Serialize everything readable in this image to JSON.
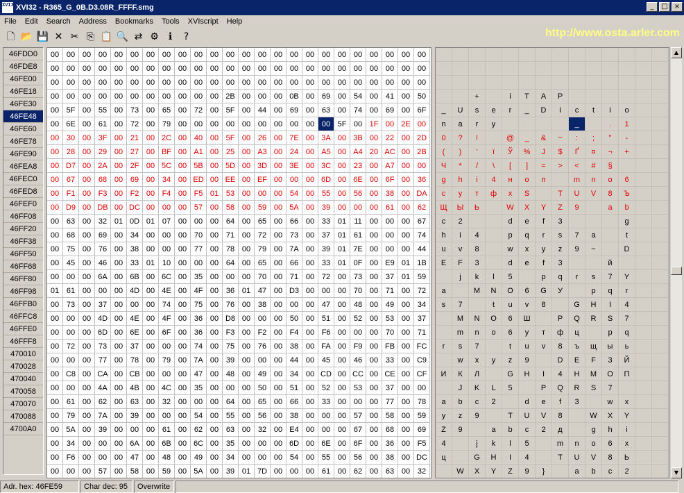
{
  "window": {
    "title": "XVI32 - R365_G_0B.D3.08R_FFFF.smg",
    "minimize": "_",
    "maximize": "□",
    "close": "×",
    "app_icon": "XVI32"
  },
  "menu": [
    "File",
    "Edit",
    "Search",
    "Address",
    "Bookmarks",
    "Tools",
    "XVIscript",
    "Help"
  ],
  "url": "http://www.osta.arler.com",
  "toolbar": [
    {
      "name": "new-file-icon",
      "glyph": "🗋"
    },
    {
      "name": "open-folder-icon",
      "glyph": "📂"
    },
    {
      "name": "save-icon",
      "glyph": "💾"
    },
    {
      "name": "close-file-icon",
      "glyph": "✕"
    },
    {
      "name": "cut-icon",
      "glyph": "✂"
    },
    {
      "name": "copy-icon",
      "glyph": "⎘"
    },
    {
      "name": "paste-icon",
      "glyph": "📋"
    },
    {
      "name": "find-icon",
      "glyph": "🔍"
    },
    {
      "name": "replace-icon",
      "glyph": "⇄"
    },
    {
      "name": "settings-icon",
      "glyph": "⚙"
    },
    {
      "name": "info-icon",
      "glyph": "ℹ"
    },
    {
      "name": "help-icon",
      "glyph": "?"
    }
  ],
  "addresses": [
    "46FDD0",
    "46FDE8",
    "46FE00",
    "46FE18",
    "46FE30",
    "46FE48",
    "46FE60",
    "46FE78",
    "46FE90",
    "46FEA8",
    "46FEC0",
    "46FED8",
    "46FEF0",
    "46FF08",
    "46FF20",
    "46FF38",
    "46FF50",
    "46FF68",
    "46FF80",
    "46FF98",
    "46FFB0",
    "46FFC8",
    "46FFE0",
    "46FFF8",
    "470010",
    "470028",
    "470040",
    "470058",
    "470070",
    "470088",
    "4700A0"
  ],
  "selected_address": "46FE48",
  "hex_rows": [
    "00 00 00 00 00 00 00 00 00 00 00 00 00 00 00 00 00 00 00 00 00 00 00 00",
    "00 00 00 00 00 00 00 00 00 00 00 00 00 00 00 00 00 00 00 00 00 00 00 00",
    "00 00 00 00 00 00 00 00 00 00 00 00 00 00 00 00 00 00 00 00 00 00 00 00",
    "00 00 00 00 00 00 00 00 00 00 00 2B 00 00 00 0B 00 69 00 54 00 41 00 50",
    "00 5F 00 55 00 73 00 65 00 72 00 5F 00 44 00 69 00 63 00 74 00 69 00 6F",
    "00 6E 00 61 00 72 00 79 00 00 00 00 00 00 00 00 5F 00 1F 00 2E 00 31",
    "00 30 00 3F 00 21 00 2C 00 40 00 5F 00 26 00 7E 00 3A 00 3B 00 22 00 2D",
    "00 28 00 29 00 27 00 BF 00 A1 00 25 00 A3 00 24 00 A5 00 A4 20 AC 00 2B",
    "00 D7 00 2A 00 2F 00 5C 00 5B 00 5D 00 3D 00 3E 00 3C 00 23 00 A7 00 00",
    "00 67 00 68 00 69 00 34 00 ED 00 EE 00 EF 00 00 00 6D 00 6E 00 6F 00 36",
    "00 F1 00 F3 00 F2 00 F4 00 F5 01 53 00 00 00 54 00 55 00 56 00 38 00 DA",
    "00 D9 00 DB 00 DC 00 00 00 57 00 58 00 59 00 5A 00 39 00 00 00 61 00 62",
    "00 63 00 32 01 0D 01 07 00 00 00 64 00 65 00 66 00 33 01 11 00 00 00 67",
    "00 68 00 69 00 34 00 00 00 70 00 71 00 72 00 73 00 37 01 61 00 00 00 74",
    "00 75 00 76 00 38 00 00 00 77 00 78 00 79 00 7A 00 39 01 7E 00 00 00 44",
    "00 45 00 46 00 33 01 10 00 00 00 64 00 65 00 66 00 33 01 0F 00 E9 01 1B",
    "00 00 00 6A 00 6B 00 6C 00 35 00 00 00 70 00 71 00 72 00 73 00 37 01 59",
    "01 61 00 00 00 4D 00 4E 00 4F 00 36 01 47 00 D3 00 00 00 70 00 71 00 72",
    "00 73 00 37 00 00 00 74 00 75 00 76 00 38 00 00 00 47 00 48 00 49 00 34",
    "00 00 00 4D 00 4E 00 4F 00 36 00 D8 00 00 00 50 00 51 00 52 00 53 00 37",
    "00 00 00 6D 00 6E 00 6F 00 36 00 F3 00 F2 00 F4 00 F6 00 00 00 70 00 71",
    "00 72 00 73 00 37 00 00 00 74 00 75 00 76 00 38 00 FA 00 F9 00 FB 00 FC",
    "00 00 00 77 00 78 00 79 00 7A 00 39 00 00 00 44 00 45 00 46 00 33 00 C9",
    "00 C8 00 CA 00 CB 00 00 00 47 00 48 00 49 00 34 00 CD 00 CC 00 CE 00 CF",
    "00 00 00 4A 00 4B 00 4C 00 35 00 00 00 50 00 51 00 52 00 53 00 37 00 00",
    "00 61 00 62 00 63 00 32 00 00 00 64 00 65 00 66 00 33 00 00 00 77 00 78",
    "00 79 00 7A 00 39 00 00 00 54 00 55 00 56 00 38 00 00 00 57 00 58 00 59",
    "00 5A 00 39 00 00 00 61 00 62 00 63 00 32 00 E4 00 00 00 67 00 68 00 69",
    "00 34 00 00 00 6A 00 6B 00 6C 00 35 00 00 00 6D 00 6E 00 6F 00 36 00 F5",
    "00 F6 00 00 00 47 00 48 00 49 00 34 00 00 00 54 00 55 00 56 00 38 00 DC",
    "00 00 00 57 00 58 00 59 00 5A 00 39 01 7D 00 00 00 61 00 62 00 63 00 32"
  ],
  "hex_row6_fix": "00 6E 00 61 00 72 00 79 00 00 00 00 00 00 00 00 00 00 5F 00 1F 00 2E 00 31",
  "red_rows": [
    5,
    6,
    7,
    8,
    9,
    10,
    11
  ],
  "red_row5_start": 20,
  "selected_hex": {
    "row": 5,
    "col": 17
  },
  "char_rows": [
    [
      "",
      "",
      "",
      "",
      "",
      "",
      "",
      "",
      "",
      "",
      "",
      "",
      "",
      ""
    ],
    [
      "",
      "",
      "",
      "",
      "",
      "",
      "",
      "",
      "",
      "",
      "",
      "",
      "",
      ""
    ],
    [
      "",
      "",
      "",
      "",
      "",
      "",
      "",
      "",
      "",
      "",
      "",
      "",
      "",
      ""
    ],
    [
      "",
      "",
      "",
      "",
      "",
      "+",
      "",
      "",
      "",
      "i",
      "",
      "T",
      "",
      "A",
      "",
      "P"
    ],
    [
      "",
      "_",
      "",
      "U",
      "",
      "s",
      "",
      "e",
      "",
      "r",
      "",
      "_",
      "",
      "D",
      "",
      "i",
      "",
      "c",
      "",
      "t",
      "",
      "i",
      "",
      "o"
    ],
    [
      "",
      "n",
      "",
      "a",
      "",
      "r",
      "",
      "y",
      "",
      "",
      "",
      "",
      "",
      "",
      "",
      "",
      "",
      "_",
      "",
      "",
      "",
      ".",
      "",
      "1"
    ],
    [
      "",
      "0",
      "",
      "?",
      "",
      "!",
      "",
      "",
      "",
      "@",
      "",
      "_",
      "",
      "&",
      "",
      "~",
      "",
      ":",
      "",
      ";",
      "",
      "\"",
      "",
      "-"
    ],
    [
      "",
      "(",
      "",
      ")",
      "",
      "'",
      "",
      "ї",
      "",
      "Ў",
      "",
      "%",
      "",
      "Ј",
      "",
      "$",
      "",
      "Ґ",
      "",
      "¤",
      "",
      "¬",
      "",
      "+"
    ],
    [
      "",
      "Ч",
      "",
      "*",
      "",
      "/",
      "",
      "\\",
      "",
      "[",
      "",
      "]",
      "",
      "=",
      "",
      ">",
      "",
      "<",
      "",
      "#",
      "",
      "§",
      ""
    ],
    [
      "",
      "g",
      "",
      "h",
      "",
      "i",
      "",
      "4",
      "",
      "н",
      "",
      "о",
      "",
      "п",
      "",
      "",
      "",
      "m",
      "",
      "n",
      "",
      "o",
      "",
      "6"
    ],
    [
      "",
      "с",
      "",
      "у",
      "",
      "т",
      "",
      "ф",
      "",
      "х",
      "",
      "S",
      "",
      "",
      "",
      "T",
      "",
      "U",
      "",
      "V",
      "",
      "8",
      "",
      "Ъ"
    ],
    [
      "",
      "Щ",
      "",
      "Ы",
      "",
      "Ь",
      "",
      "",
      "",
      "W",
      "",
      "X",
      "",
      "Y",
      "",
      "Z",
      "",
      "9",
      "",
      "",
      "",
      "a",
      "",
      "b"
    ],
    [
      "",
      "c",
      "",
      "2",
      "",
      "",
      "",
      "",
      "",
      "d",
      "",
      "e",
      "",
      "f",
      "",
      "3",
      "",
      "",
      "",
      "",
      "",
      "",
      "",
      "g"
    ],
    [
      "",
      "h",
      "",
      "i",
      "",
      "4",
      "",
      "",
      "",
      "p",
      "",
      "q",
      "",
      "r",
      "",
      "s",
      "",
      "7",
      "",
      "a",
      "",
      "",
      "",
      "t"
    ],
    [
      "",
      "u",
      "",
      "v",
      "",
      "8",
      "",
      "",
      "",
      "w",
      "",
      "x",
      "",
      "y",
      "",
      "z",
      "",
      "9",
      "",
      "~",
      "",
      "",
      "",
      "D"
    ],
    [
      "",
      "E",
      "",
      "F",
      "",
      "3",
      "",
      "",
      "",
      "d",
      "",
      "e",
      "",
      "f",
      "",
      "3",
      "",
      "",
      "",
      "",
      "",
      "й",
      "",
      ""
    ],
    [
      "",
      "",
      "",
      "j",
      "",
      "k",
      "",
      "l",
      "",
      "5",
      "",
      "",
      "",
      "p",
      "",
      "q",
      "",
      "r",
      "",
      "s",
      "",
      "7",
      "",
      "Y"
    ],
    [
      "",
      "a",
      "",
      "",
      "",
      "M",
      "",
      "N",
      "",
      "O",
      "",
      "6",
      "",
      "G",
      "",
      "У",
      "",
      "",
      "",
      "p",
      "",
      "q",
      "",
      "r"
    ],
    [
      "",
      "s",
      "",
      "7",
      "",
      "",
      "",
      "t",
      "",
      "u",
      "",
      "v",
      "",
      "8",
      "",
      "",
      "",
      "G",
      "",
      "H",
      "",
      "I",
      "",
      "4"
    ],
    [
      "",
      "",
      "",
      "M",
      "",
      "N",
      "",
      "O",
      "",
      "6",
      "",
      "Ш",
      "",
      "",
      "",
      "P",
      "",
      "Q",
      "",
      "R",
      "",
      "S",
      "",
      "7"
    ],
    [
      "",
      "",
      "",
      "m",
      "",
      "n",
      "",
      "o",
      "",
      "6",
      "",
      "у",
      "",
      "т",
      "",
      "ф",
      "",
      "ц",
      "",
      "",
      "",
      "p",
      "",
      "q"
    ],
    [
      "",
      "r",
      "",
      "s",
      "",
      "7",
      "",
      "",
      "",
      "t",
      "",
      "u",
      "",
      "v",
      "",
      "8",
      "",
      "ъ",
      "",
      "щ",
      "",
      "ы",
      "",
      "ь"
    ],
    [
      "",
      "",
      "",
      "w",
      "",
      "x",
      "",
      "y",
      "",
      "z",
      "",
      "9",
      "",
      "",
      "",
      "D",
      "",
      "E",
      "",
      "F",
      "",
      "3",
      "",
      "Й"
    ],
    [
      "",
      "И",
      "",
      "К",
      "",
      "Л",
      "",
      "",
      "",
      "G",
      "",
      "H",
      "",
      "I",
      "",
      "4",
      "",
      "Н",
      "",
      "М",
      "",
      "О",
      "",
      "П"
    ],
    [
      "",
      "",
      "",
      "J",
      "",
      "K",
      "",
      "L",
      "",
      "5",
      "",
      "",
      "",
      "P",
      "",
      "Q",
      "",
      "R",
      "",
      "S",
      "",
      "7",
      ""
    ],
    [
      "",
      "a",
      "",
      "b",
      "",
      "c",
      "",
      "2",
      "",
      "",
      "",
      "d",
      "",
      "e",
      "",
      "f",
      "",
      "3",
      "",
      "",
      "",
      "w",
      "",
      "x"
    ],
    [
      "",
      "y",
      "",
      "z",
      "",
      "9",
      "",
      "",
      "",
      "T",
      "",
      "U",
      "",
      "V",
      "",
      "8",
      "",
      "",
      "",
      "W",
      "",
      "X",
      "",
      "Y"
    ],
    [
      "",
      "Z",
      "",
      "9",
      "",
      "",
      "",
      "a",
      "",
      "b",
      "",
      "c",
      "",
      "2",
      "",
      "д",
      "",
      "",
      "",
      "g",
      "",
      "h",
      "",
      "i"
    ],
    [
      "",
      "4",
      "",
      "",
      "",
      "j",
      "",
      "k",
      "",
      "l",
      "",
      "5",
      "",
      "",
      "",
      "m",
      "",
      "n",
      "",
      "o",
      "",
      "6",
      "",
      "х"
    ],
    [
      "",
      "ц",
      "",
      "",
      "",
      "G",
      "",
      "H",
      "",
      "I",
      "",
      "4",
      "",
      "",
      "",
      "T",
      "",
      "U",
      "",
      "V",
      "",
      "8",
      "",
      "Ь"
    ],
    [
      "",
      "",
      "",
      "W",
      "",
      "X",
      "",
      "Y",
      "",
      "Z",
      "",
      "9",
      "",
      "}",
      "",
      "",
      "",
      "a",
      "",
      "b",
      "",
      "c",
      "",
      "2"
    ]
  ],
  "status": {
    "address": "Adr. hex: 46FE59",
    "char": "Char dec: 95",
    "mode": "Overwrite"
  }
}
